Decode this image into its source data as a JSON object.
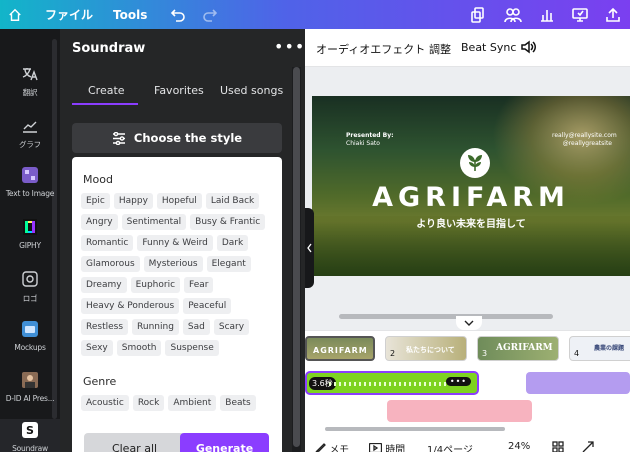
{
  "topbar": {
    "file_label": "ファイル",
    "tools_label": "Tools"
  },
  "rail": {
    "items": [
      {
        "label": "翻訳"
      },
      {
        "label": "グラフ"
      },
      {
        "label": "Text to Image"
      },
      {
        "label": "GIPHY"
      },
      {
        "label": "ロゴ"
      },
      {
        "label": "Mockups"
      },
      {
        "label": "D-ID AI Pres..."
      },
      {
        "label": "Soundraw"
      }
    ]
  },
  "panel": {
    "title": "Soundraw",
    "more": "•••",
    "tabs": [
      {
        "label": "Create",
        "active": true
      },
      {
        "label": "Favorites"
      },
      {
        "label": "Used songs"
      }
    ],
    "style_button": "Choose the style",
    "mood_title": "Mood",
    "moods": [
      "Epic",
      "Happy",
      "Hopeful",
      "Laid Back",
      "Angry",
      "Sentimental",
      "Busy & Frantic",
      "Romantic",
      "Funny & Weird",
      "Dark",
      "Glamorous",
      "Mysterious",
      "Elegant",
      "Dreamy",
      "Euphoric",
      "Fear",
      "Heavy & Ponderous",
      "Peaceful",
      "Restless",
      "Running",
      "Sad",
      "Scary",
      "Sexy",
      "Smooth",
      "Suspense"
    ],
    "genre_title": "Genre",
    "genres": [
      "Acoustic",
      "Rock",
      "Ambient",
      "Beats"
    ],
    "clear_label": "Clear all",
    "generate_label": "Generate"
  },
  "editor": {
    "effects_label": "オーディオエフェクト",
    "adjust_label": "調整",
    "beat_sync_label": "Beat Sync"
  },
  "slide": {
    "presented_by": "Presented By:",
    "presenter": "Chiaki Sato",
    "email": "really@reallysite.com",
    "handle": "@reallygreatsite",
    "title": "AGRIFARM",
    "subtitle": "より良い未来を目指して"
  },
  "timeline": {
    "pages": [
      {
        "num": "",
        "text": "AGRIFARM"
      },
      {
        "num": "2",
        "text": "私たちについて"
      },
      {
        "num": "3",
        "text": "AGRIFARM"
      },
      {
        "num": "4",
        "text": "農業の課題"
      }
    ],
    "audio_label": "3.6秒",
    "audio_more": "•••"
  },
  "status": {
    "notes": "メモ",
    "time": "時間",
    "pages": "1/4ページ",
    "zoom": "24%"
  },
  "colors": {
    "accent": "#8b3dff",
    "audio_green": "#7ed321",
    "topbar_start": "#12b5c9",
    "topbar_end": "#7b3ff0"
  }
}
